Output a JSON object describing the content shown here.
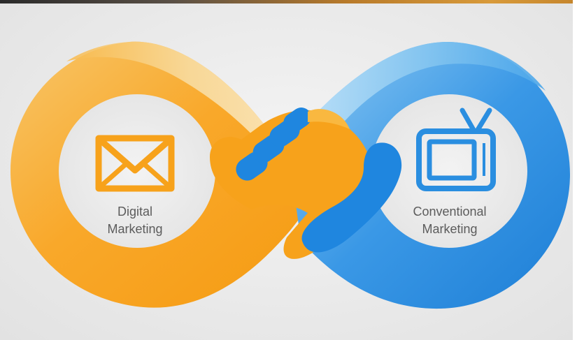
{
  "diagram": {
    "left": {
      "icon": "envelope-icon",
      "label_line1": "Digital",
      "label_line2": "Marketing",
      "color": "#f7a21b"
    },
    "right": {
      "icon": "tv-icon",
      "label_line1": "Conventional",
      "label_line2": "Marketing",
      "color": "#2a8ee0"
    },
    "center": {
      "icon": "handshake-icon"
    }
  },
  "colors": {
    "orange": "#f7a21b",
    "orange_light": "#f9dca0",
    "blue": "#2a8ee0",
    "blue_light": "#a8d6f4",
    "text": "#5c5c5c",
    "background": "#ececec"
  }
}
